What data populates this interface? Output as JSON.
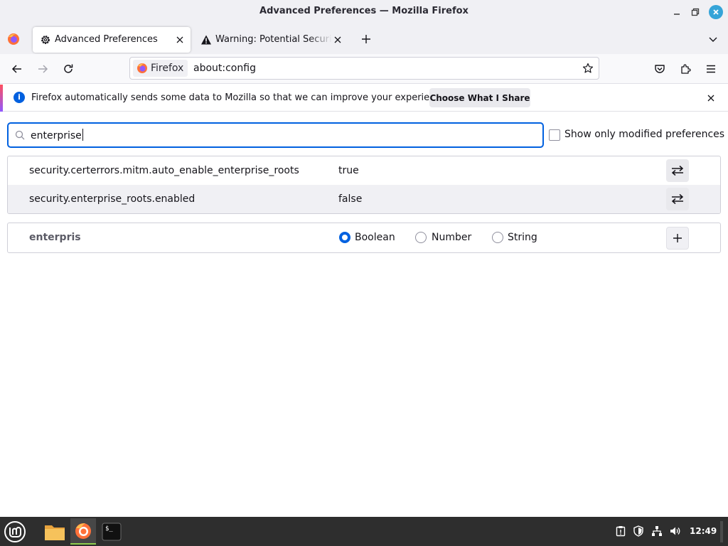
{
  "window": {
    "title": "Advanced Preferences — Mozilla Firefox"
  },
  "tabs": [
    {
      "label": "Advanced Preferences",
      "icon": "gear-icon",
      "active": true
    },
    {
      "label": "Warning: Potential Security Risk Ahead",
      "icon": "warning-icon",
      "active": false
    }
  ],
  "urlbar": {
    "identity_label": "Firefox",
    "url": "about:config"
  },
  "notification": {
    "message": "Firefox automatically sends some data to Mozilla so that we can improve your experience.",
    "button_label": "Choose What I Share",
    "info_glyph": "i"
  },
  "search": {
    "value": "enterprise"
  },
  "filter": {
    "label": "Show only modified preferences",
    "checked": false
  },
  "preferences": [
    {
      "name": "security.certerrors.mitm.auto_enable_enterprise_roots",
      "value": "true"
    },
    {
      "name": "security.enterprise_roots.enabled",
      "value": "false"
    }
  ],
  "new_pref": {
    "name": "enterpris",
    "types": [
      {
        "label": "Boolean",
        "checked": true
      },
      {
        "label": "Number",
        "checked": false
      },
      {
        "label": "String",
        "checked": false
      }
    ]
  },
  "taskbar": {
    "clock": "12:49",
    "apps": [
      "files-icon",
      "firefox-icon",
      "terminal-icon"
    ]
  },
  "colors": {
    "accent": "#0061e0",
    "taskbar_bg": "#2e2e2e",
    "active_app_indicator": "#8fce4e"
  }
}
